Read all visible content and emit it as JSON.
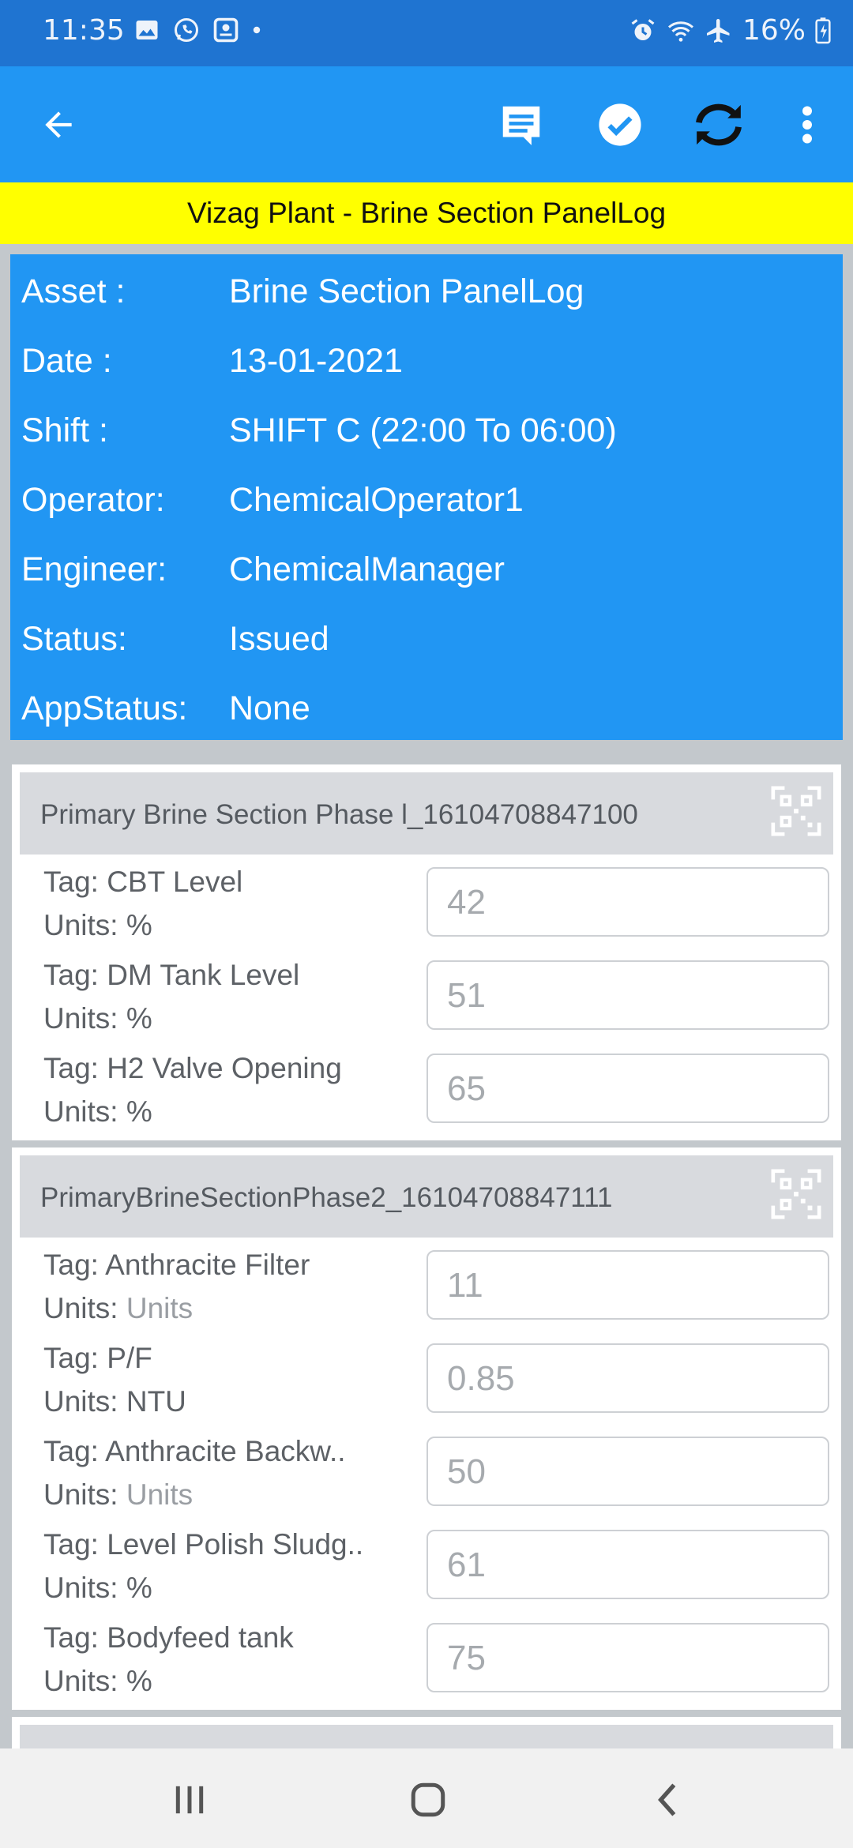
{
  "status_bar": {
    "time": "11:35",
    "battery": "16%",
    "icons": [
      "image-icon",
      "whatsapp-icon",
      "app-icon",
      "dot-icon",
      "alarm-icon",
      "wifi-icon",
      "airplane-icon",
      "battery-icon"
    ]
  },
  "app_bar": {
    "icons": [
      "back-arrow-icon",
      "comment-icon",
      "check-circle-icon",
      "sync-icon",
      "more-vert-icon"
    ]
  },
  "banner": {
    "text": "Vizag Plant - Brine Section PanelLog"
  },
  "info": [
    {
      "key": "Asset :",
      "value": "Brine Section PanelLog"
    },
    {
      "key": "Date :",
      "value": "13-01-2021"
    },
    {
      "key": "Shift :",
      "value": "SHIFT C (22:00 To 06:00)"
    },
    {
      "key": "Operator:",
      "value": "ChemicalOperator1"
    },
    {
      "key": "Engineer:",
      "value": "ChemicalManager"
    },
    {
      "key": "Status:",
      "value": "Issued"
    },
    {
      "key": "AppStatus:",
      "value": "None"
    }
  ],
  "sections": [
    {
      "title": "Primary Brine Section Phase  l_16104708847100",
      "tags": [
        {
          "tag": "Tag: CBT Level",
          "units_label": "Units:",
          "units": "%",
          "value": "42"
        },
        {
          "tag": "Tag: DM Tank Level",
          "units_label": "Units:",
          "units": "%",
          "value": "51"
        },
        {
          "tag": "Tag: H2 Valve Opening",
          "units_label": "Units:",
          "units": "%",
          "value": "65"
        }
      ]
    },
    {
      "title": "PrimaryBrineSectionPhase2_16104708847111",
      "tags": [
        {
          "tag": "Tag: Anthracite Filter",
          "units_label": "Units:",
          "units": "Units",
          "value": "11"
        },
        {
          "tag": "Tag: P/F",
          "units_label": "Units:",
          "units": "NTU",
          "value": "0.85"
        },
        {
          "tag": "Tag: Anthracite Backw..",
          "units_label": "Units:",
          "units": "Units",
          "value": "50"
        },
        {
          "tag": "Tag: Level Polish Sludg..",
          "units_label": "Units:",
          "units": "%",
          "value": "61"
        },
        {
          "tag": "Tag: Bodyfeed tank",
          "units_label": "Units:",
          "units": "%",
          "value": "75"
        }
      ]
    }
  ],
  "nav_bar": {
    "icons": [
      "recents-icon",
      "home-icon",
      "back-icon"
    ]
  }
}
